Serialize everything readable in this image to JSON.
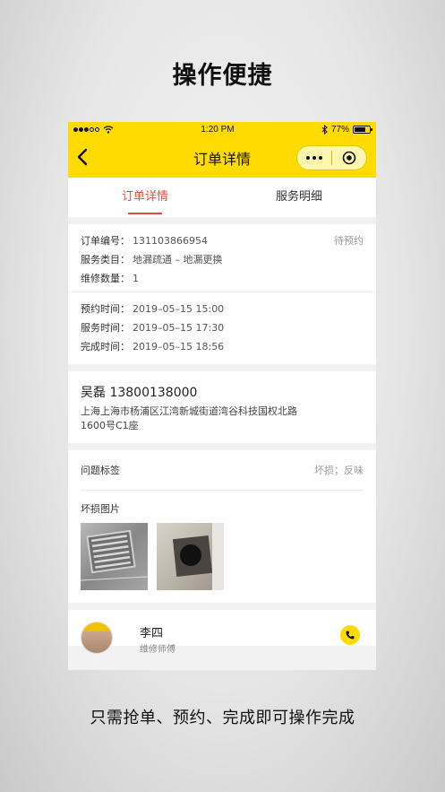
{
  "headline": "操作便捷",
  "caption": "只需抢单、预约、完成即可操作完成",
  "status_bar": {
    "time": "1:20 PM",
    "battery": "77%",
    "battery_level": 0.77
  },
  "nav": {
    "title": "订单详情",
    "back_icon": "chevron-left-icon",
    "menu_icon": "more-dots-icon",
    "close_icon": "target-circle-icon"
  },
  "tabs": [
    {
      "label": "订单详情",
      "active": true
    },
    {
      "label": "服务明细",
      "active": false
    }
  ],
  "order": {
    "status": "待预约",
    "fields": [
      {
        "label": "订单编号：",
        "value": "131103866954"
      },
      {
        "label": "服务类目：",
        "value": "地漏疏通 – 地漏更换"
      },
      {
        "label": "维修数量：",
        "value": "1"
      }
    ],
    "times": [
      {
        "label": "预约时间：",
        "value": "2019–05–15 15:00"
      },
      {
        "label": "服务时间：",
        "value": "2019–05–15 17:30"
      },
      {
        "label": "完成时间：",
        "value": "2019–05–15 18:56"
      }
    ]
  },
  "contact": {
    "name_phone": "吴磊 13800138000",
    "address_line1": "上海上海市杨浦区江湾新城街道湾谷科技国权北路",
    "address_line2": "1600号C1座"
  },
  "issue": {
    "label": "问题标签",
    "value": "坏损；反味"
  },
  "photos": {
    "title": "坏损图片",
    "count": 2
  },
  "worker": {
    "name": "李四",
    "subtitle": "维修师傅"
  },
  "colors": {
    "brand_yellow": "#ffdb00",
    "active_red": "#e54d42"
  }
}
